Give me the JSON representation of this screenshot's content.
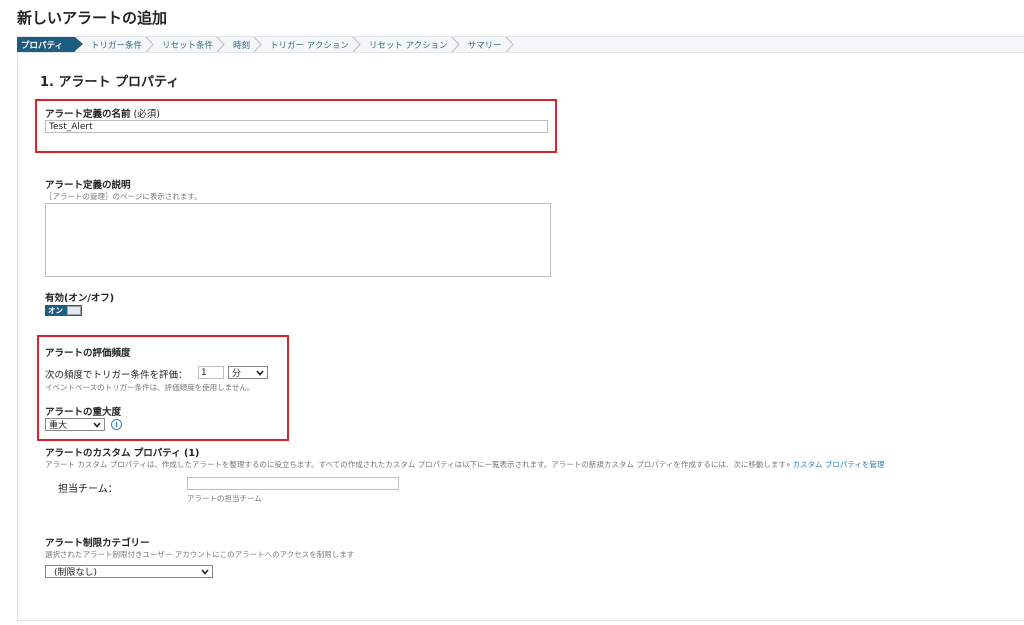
{
  "page": {
    "title": "新しいアラートの追加"
  },
  "wizard": {
    "steps": [
      {
        "label": "プロパティ",
        "active": true
      },
      {
        "label": "トリガー条件",
        "active": false
      },
      {
        "label": "リセット条件",
        "active": false
      },
      {
        "label": "時刻",
        "active": false
      },
      {
        "label": "トリガー アクション",
        "active": false
      },
      {
        "label": "リセット アクション",
        "active": false
      },
      {
        "label": "サマリー",
        "active": false
      }
    ]
  },
  "form": {
    "section_title": "1. アラート プロパティ",
    "name": {
      "label": "アラート定義の名前",
      "required": "(必須)",
      "value": "Test_Alert"
    },
    "description": {
      "label": "アラート定義の説明",
      "hint": "［アラートの管理］のページに表示されます。",
      "value": ""
    },
    "enabled": {
      "label": "有効(オン/オフ)",
      "state": "オン"
    },
    "frequency": {
      "label": "アラートの評価頻度",
      "prompt": "次の頻度でトリガー条件を評価：",
      "value": "1",
      "unit": "分",
      "hint": "イベントベースのトリガー条件は、評価頻度を使用しません。"
    },
    "severity": {
      "label": "アラートの重大度",
      "value": "重大"
    },
    "custom_properties": {
      "label": "アラートのカスタム プロパティ (1)",
      "hint": "アラート カスタム プロパティは、作成したアラートを整理するのに役立ちます。すべての作成されたカスタム プロパティは以下に一覧表示されます。アラートの新規カスタム プロパティを作成するには、次に移動します»",
      "link": "カスタム プロパティを管理",
      "team_label": "担当チーム：",
      "team_value": "",
      "team_hint": "アラートの担当チーム"
    },
    "restriction": {
      "label": "アラート制限カテゴリー",
      "hint": "選択されたアラート制限付きユーザー アカウントにこのアラートへのアクセスを制限します",
      "value": "(制限なし)"
    }
  },
  "colors": {
    "accent": "#1f5d80",
    "highlight": "#d9252e",
    "link": "#2c7cb8"
  }
}
